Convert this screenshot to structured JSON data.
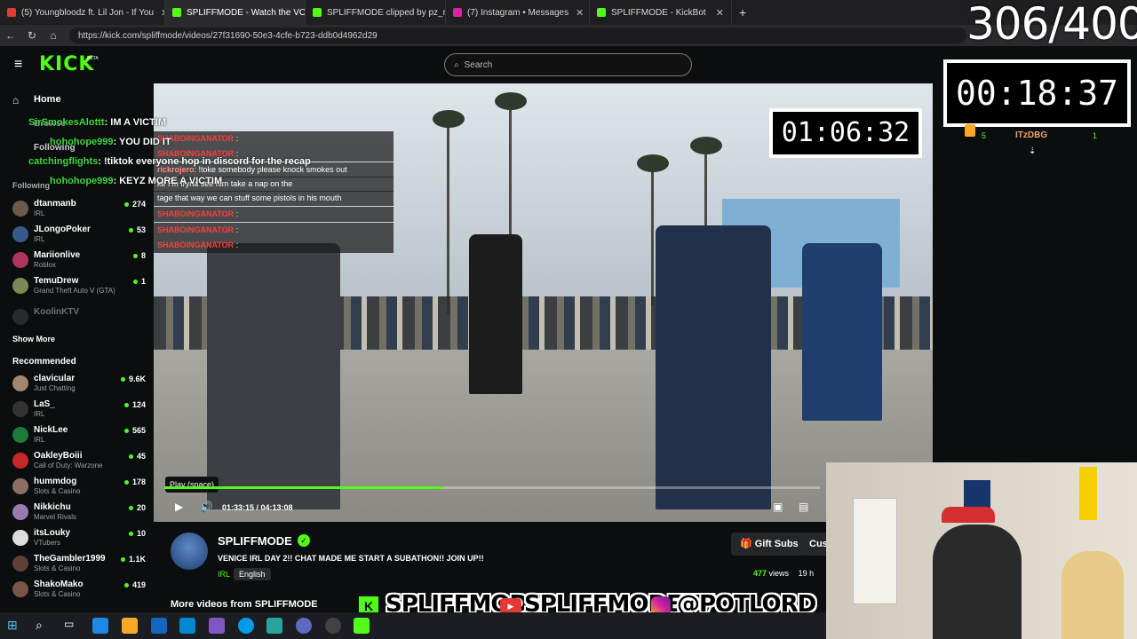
{
  "browser": {
    "tabs": [
      {
        "label": "(5) Youngbloodz ft. Lil Jon - If You",
        "color": "#e53935"
      },
      {
        "label": "SPLIFFMODE - Watch the VOD on",
        "color": "#53fc18"
      },
      {
        "label": "SPLIFFMODE clipped by pz_makin",
        "color": "#53fc18"
      },
      {
        "label": "(7) Instagram • Messages",
        "color": "#d6249f"
      },
      {
        "label": "SPLIFFMODE - KickBot",
        "color": "#53fc18"
      }
    ],
    "new_tab": "+",
    "url": "https://kick.com/spliffmode/videos/27f31690-50e3-4cfe-b723-ddb0d4962d29"
  },
  "header": {
    "logo": "KICK",
    "logo_badge": "BETA",
    "search_placeholder": "Search"
  },
  "sidebar": {
    "nav": [
      {
        "label": "Home"
      },
      {
        "label": "Browse"
      },
      {
        "label": "Following"
      }
    ],
    "following_title": "Following",
    "following": [
      {
        "name": "dtanmanb",
        "category": "IRL",
        "viewers": "274",
        "avatar": "#6c5b4b"
      },
      {
        "name": "JLongoPoker",
        "category": "IRL",
        "viewers": "53",
        "avatar": "#3a5a8a"
      },
      {
        "name": "Mariionlive",
        "category": "Roblox",
        "viewers": "8",
        "avatar": "#b0345a"
      },
      {
        "name": "TemuDrew",
        "category": "Grand Theft Auto V (GTA)",
        "viewers": "1",
        "avatar": "#7b8a55"
      },
      {
        "name": "KoolinKTV",
        "category": "",
        "viewers": "",
        "avatar": "#555"
      }
    ],
    "show_more": "Show More",
    "recommended_title": "Recommended",
    "recommended": [
      {
        "name": "clavicular",
        "category": "Just Chatting",
        "viewers": "9.6K",
        "avatar": "#a1866d"
      },
      {
        "name": "LaS_",
        "category": "IRL",
        "viewers": "124",
        "avatar": "#333"
      },
      {
        "name": "NickLee",
        "category": "IRL",
        "viewers": "565",
        "avatar": "#1f7a3a"
      },
      {
        "name": "OakleyBoiii",
        "category": "Call of Duty: Warzone",
        "viewers": "45",
        "avatar": "#c62828"
      },
      {
        "name": "hummdog",
        "category": "Slots & Casino",
        "viewers": "178",
        "avatar": "#8d6e63"
      },
      {
        "name": "Nikkichu",
        "category": "Marvel Rivals",
        "viewers": "20",
        "avatar": "#9c7ab0"
      },
      {
        "name": "itsLouky",
        "category": "VTubers",
        "viewers": "10",
        "avatar": "#ddd"
      },
      {
        "name": "TheGambler1999",
        "category": "Slots & Casino",
        "viewers": "1.1K",
        "avatar": "#5d4037"
      },
      {
        "name": "ShakoMako",
        "category": "Slots & Casino",
        "viewers": "419",
        "avatar": "#795548"
      }
    ]
  },
  "chat_overlay": [
    {
      "name": "SirSmokesAlottt",
      "msg": ": IM A VICTIM"
    },
    {
      "name": "hohohope999",
      "msg": ": YOU DID IT"
    },
    {
      "name": "catchingflights",
      "msg": ": !tiktok everyone hop in discord for the recap"
    },
    {
      "name": "hohohope999",
      "msg": ": KEYZ MORE A VICTIM"
    }
  ],
  "video_chat_inset": [
    {
      "name": "SHABOINGANATOR",
      "msg": ":"
    },
    {
      "name": "SHABOINGANATOR",
      "msg": ":"
    },
    {
      "name": "rickrojero",
      "msg": ": !toke somebody please knock smokes out"
    },
    {
      "name": "",
      "msg": "ke I'm tryna see him take a nap on the"
    },
    {
      "name": "",
      "msg": "tage that way we can stuff some pistols in his mouth"
    },
    {
      "name": "SHABOINGANATOR",
      "msg": ":"
    },
    {
      "name": "SHABOINGANATOR",
      "msg": ":"
    },
    {
      "name": "SHABOINGANATOR",
      "msg": ":"
    }
  ],
  "video": {
    "timer": "01:06:32",
    "tooltip": "Play (space)",
    "time_display": "01:33:15 / 04:13:08",
    "progress_fraction": 0.426
  },
  "channel": {
    "name": "SPLIFFMODE",
    "title": "VENICE IRL DAY 2!! CHAT MADE ME START A SUBATHON!! JOIN UP!!",
    "category": "IRL",
    "language": "English",
    "gift_subs": "Gift Subs",
    "cus_button": "Cus",
    "views_count": "477",
    "views_label": "views",
    "age": "19 h",
    "more_videos": "More videos from SPLIFFMODE"
  },
  "overlay": {
    "counter": "306/400",
    "stream_timer": "00:18:37",
    "chat_user": "ITzDBG",
    "chat_num_left": "5",
    "chat_num_right": "1",
    "banner_kick": "SPLIFFMODE",
    "banner_youtube": "SPLIFFMODETV",
    "banner_instagram": "@POTLORD"
  },
  "colors": {
    "kick_green": "#53fc18",
    "background": "#0b0e0f",
    "chat_name": "#3ddc3d",
    "inset_name": "#ff3b3b"
  }
}
